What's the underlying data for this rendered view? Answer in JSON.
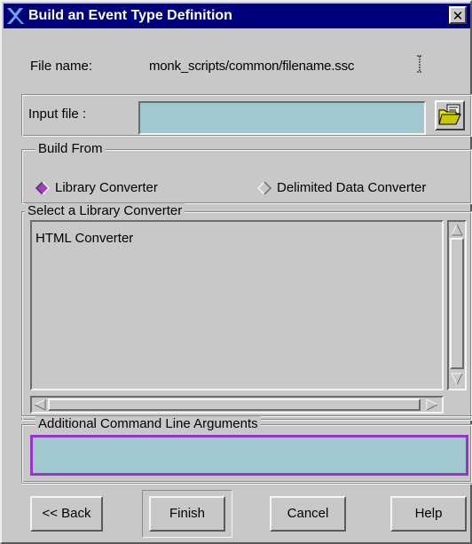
{
  "window": {
    "title": "Build an Event Type Definition",
    "close_label": "✕"
  },
  "file_name": {
    "label": "File name:",
    "value": "monk_scripts/common/filename.ssc"
  },
  "input_file": {
    "label": "Input file :",
    "value": "",
    "browse_icon": "folder-open-icon"
  },
  "build_from": {
    "title": "Build From",
    "options": [
      {
        "label": "Library Converter",
        "selected": true
      },
      {
        "label": "Delimited Data Converter",
        "selected": false
      }
    ]
  },
  "library_converter": {
    "title": "Select a Library Converter",
    "items": [
      "HTML Converter"
    ]
  },
  "additional_args": {
    "title": "Additional Command Line Arguments",
    "value": ""
  },
  "buttons": {
    "back": "<< Back",
    "finish": "Finish",
    "cancel": "Cancel",
    "help": "Help"
  },
  "colors": {
    "titlebar": "#00007b",
    "field_fill": "#9fc8d0",
    "focus_border": "#9933cc",
    "radio_selected": "#a040c0"
  }
}
